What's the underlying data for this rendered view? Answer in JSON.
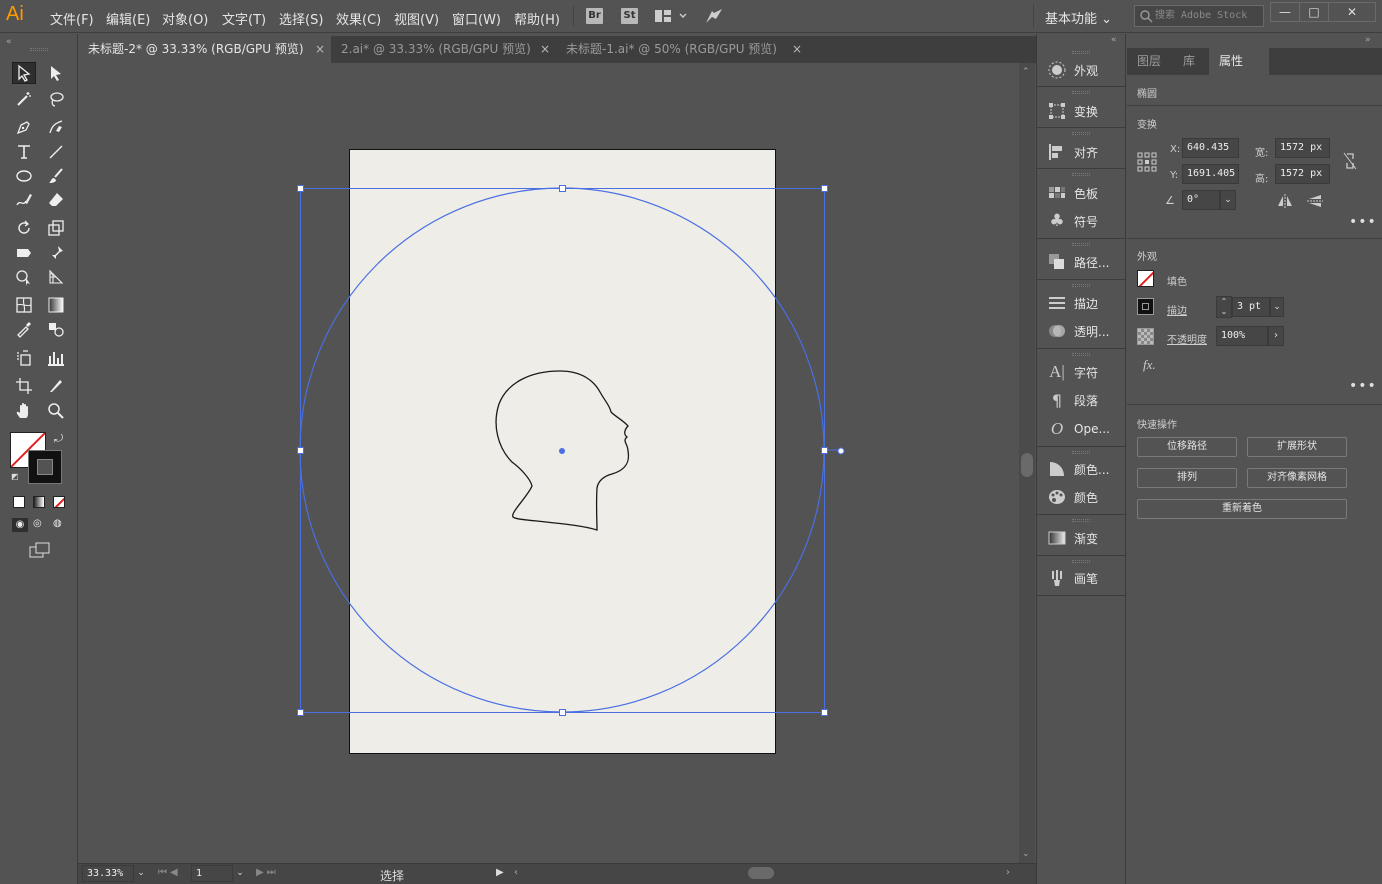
{
  "app": {
    "logo": "Ai"
  },
  "menu": [
    "文件(F)",
    "编辑(E)",
    "对象(O)",
    "文字(T)",
    "选择(S)",
    "效果(C)",
    "视图(V)",
    "窗口(W)",
    "帮助(H)"
  ],
  "bridge_buttons": [
    "Br",
    "St"
  ],
  "workspace": "基本功能",
  "stock_search_placeholder": "搜索 Adobe Stock",
  "window_controls": [
    "—",
    "□",
    "✕"
  ],
  "tabs": [
    {
      "label": "未标题-2* @ 33.33% (RGB/GPU 预览)",
      "active": true
    },
    {
      "label": "2.ai* @ 33.33% (RGB/GPU 预览)",
      "active": false
    },
    {
      "label": "未标题-1.ai* @ 50% (RGB/GPU 预览)",
      "active": false
    }
  ],
  "tab_close": "×",
  "dock": [
    {
      "label": "外观",
      "icon": "appearance-icon"
    },
    {
      "label": "变换",
      "icon": "transform-icon"
    },
    {
      "label": "对齐",
      "icon": "align-icon"
    },
    {
      "label": "色板",
      "icon": "swatches-icon"
    },
    {
      "label": "符号",
      "icon": "symbols-icon"
    },
    {
      "label": "路径...",
      "icon": "pathfinder-icon"
    },
    {
      "label": "描边",
      "icon": "stroke-icon"
    },
    {
      "label": "透明...",
      "icon": "transparency-icon"
    },
    {
      "label": "字符",
      "icon": "character-icon"
    },
    {
      "label": "段落",
      "icon": "paragraph-icon"
    },
    {
      "label": "Ope...",
      "icon": "opentype-icon"
    },
    {
      "label": "颜色...",
      "icon": "color-guide-icon"
    },
    {
      "label": "颜色",
      "icon": "color-icon"
    },
    {
      "label": "渐变",
      "icon": "gradient-icon"
    },
    {
      "label": "画笔",
      "icon": "brushes-icon"
    }
  ],
  "props": {
    "tabs": [
      {
        "label": "图层",
        "active": false
      },
      {
        "label": "库",
        "active": false
      },
      {
        "label": "属性",
        "active": true
      }
    ],
    "object_type": "椭圆",
    "transform_title": "变换",
    "x_label": "X:",
    "x": "640.435",
    "y_label": "Y:",
    "y": "1691.405",
    "w_label": "宽:",
    "w": "1572 px",
    "h_label": "高:",
    "h": "1572 px",
    "angle": "0°",
    "appearance_title": "外观",
    "fill_label": "填色",
    "stroke_label": "描边",
    "stroke_value": "3 pt",
    "opacity_label": "不透明度",
    "opacity_value": "100%",
    "fx": "fx.",
    "quick_title": "快速操作",
    "quick_buttons": [
      "位移路径",
      "扩展形状",
      "排列",
      "对齐像素网格"
    ],
    "recolor": "重新着色"
  },
  "status": {
    "zoom": "33.33%",
    "artboard": "1",
    "tool": "选择"
  },
  "colors": {
    "selection": "#4a6fe3",
    "artboard": "#eeede8",
    "bg": "#535353",
    "panel_dark": "#3e3e3e"
  }
}
